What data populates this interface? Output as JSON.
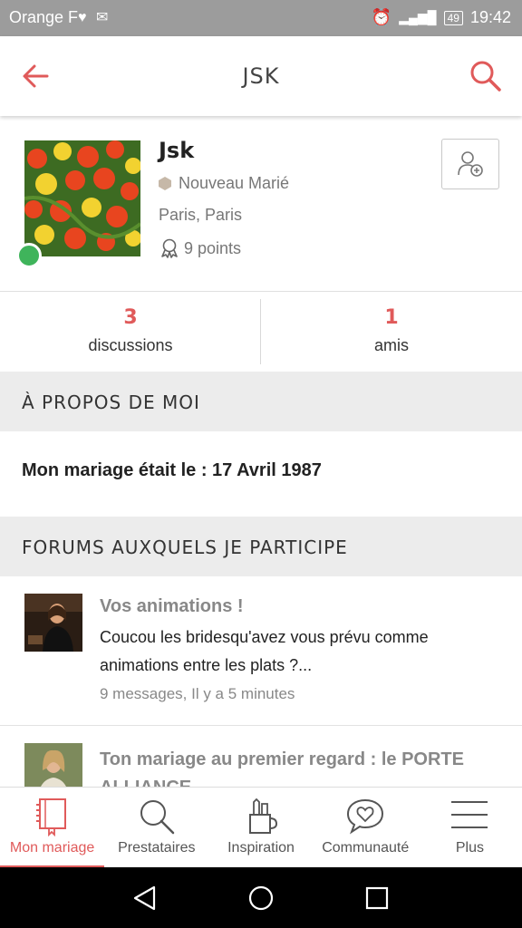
{
  "status_bar": {
    "carrier": "Orange F",
    "battery": "49",
    "time": "19:42"
  },
  "app_bar": {
    "title": "JSK"
  },
  "profile": {
    "name": "Jsk",
    "role": "Nouveau Marié",
    "location": "Paris, Paris",
    "points": "9 points",
    "online": true
  },
  "stats": [
    {
      "value": "3",
      "label": "discussions"
    },
    {
      "value": "1",
      "label": "amis"
    }
  ],
  "about": {
    "heading": "À PROPOS DE MOI",
    "text": "Mon mariage était le : 17 Avril 1987"
  },
  "forums": {
    "heading": "FORUMS AUXQUELS JE PARTICIPE",
    "items": [
      {
        "title": "Vos animations !",
        "excerpt": "Coucou les bridesqu'avez vous prévu comme animations entre les plats ?...",
        "meta": "9 messages, Il y a 5 minutes"
      },
      {
        "title": "Ton mariage au premier regard : le PORTE ALLIANCE",
        "excerpt": "",
        "meta": ""
      }
    ]
  },
  "bottom_nav": [
    {
      "label": "Mon mariage",
      "icon": "notebook-icon",
      "active": true
    },
    {
      "label": "Prestataires",
      "icon": "search-icon",
      "active": false
    },
    {
      "label": "Inspiration",
      "icon": "pencil-cup-icon",
      "active": false
    },
    {
      "label": "Communauté",
      "icon": "heart-chat-icon",
      "active": false
    },
    {
      "label": "Plus",
      "icon": "menu-icon",
      "active": false
    }
  ],
  "colors": {
    "accent": "#e05a5a",
    "online": "#3fb45b",
    "section_bg": "#ececec"
  }
}
